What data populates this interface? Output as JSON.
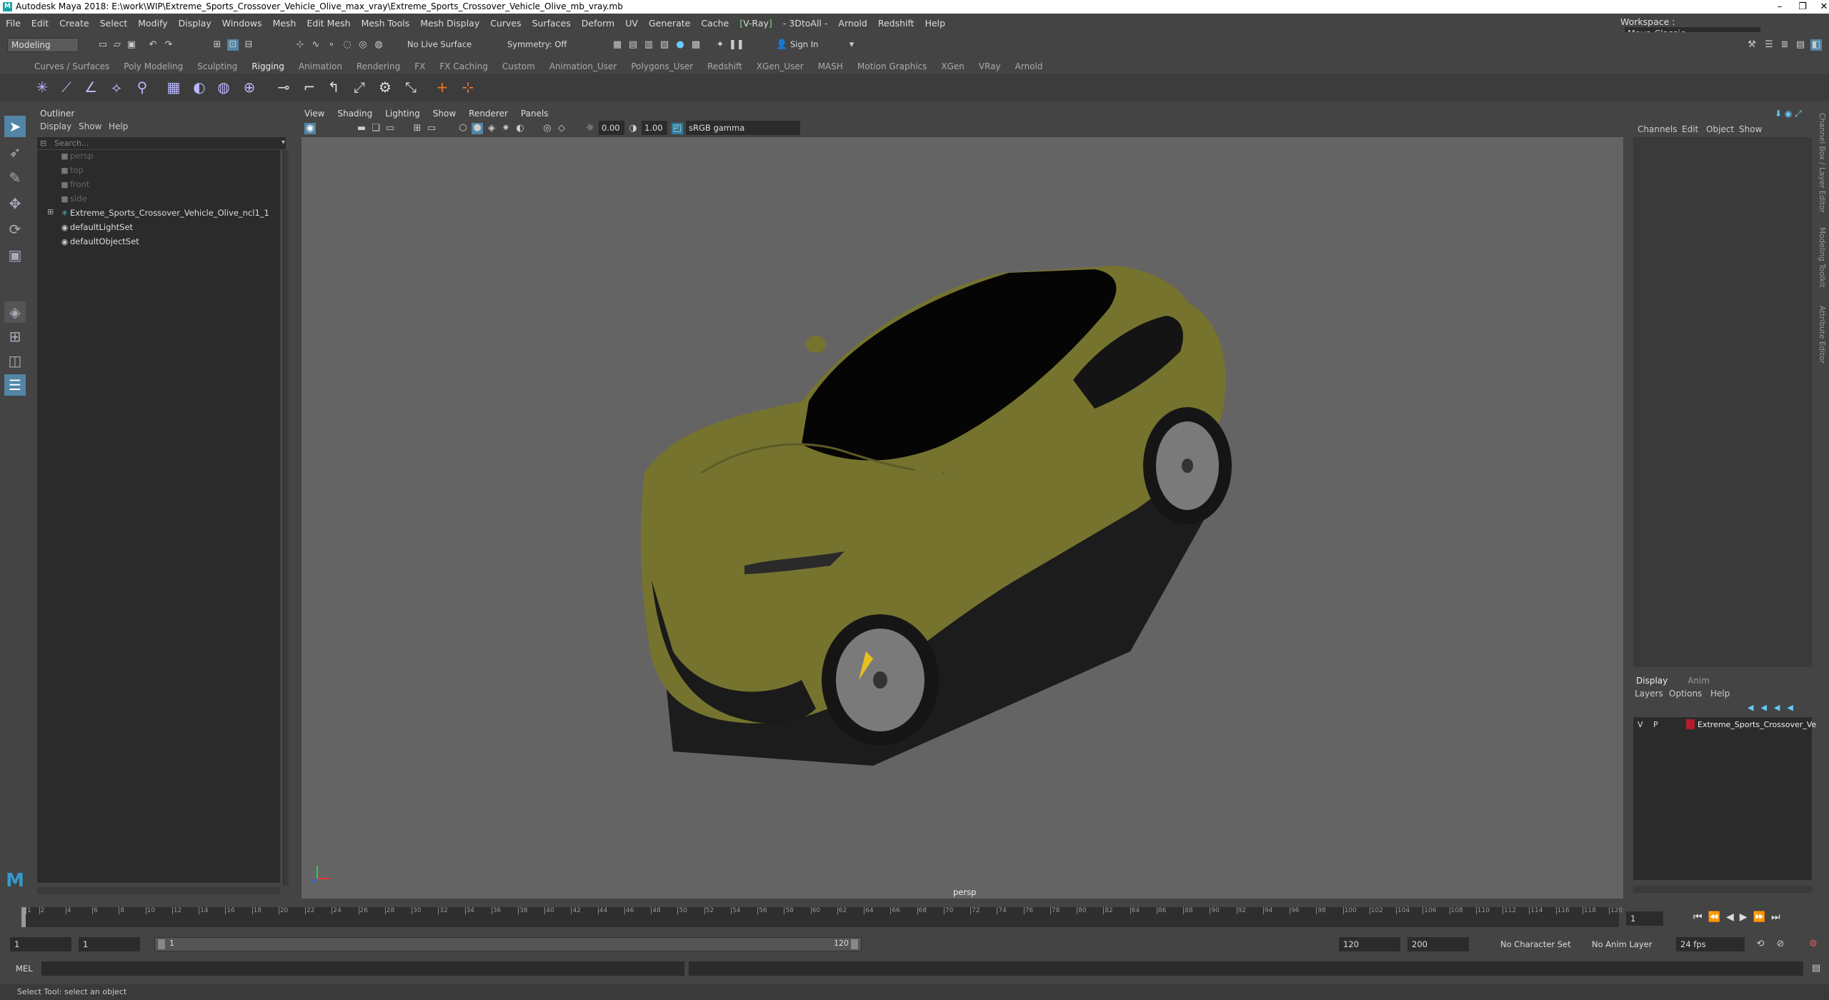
{
  "window": {
    "title": "Autodesk Maya 2018: E:\\work\\WIP\\Extreme_Sports_Crossover_Vehicle_Olive_max_vray\\Extreme_Sports_Crossover_Vehicle_Olive_mb_vray.mb",
    "icon": "maya-icon",
    "buttons": [
      "minimize-icon",
      "restore-icon",
      "close-icon"
    ]
  },
  "menubar": {
    "items": [
      "File",
      "Edit",
      "Create",
      "Select",
      "Modify",
      "Display",
      "Windows",
      "Mesh",
      "Edit Mesh",
      "Mesh Tools",
      "Mesh Display",
      "Curves",
      "Surfaces",
      "Deform",
      "UV",
      "Generate",
      "Cache",
      "V-Ray",
      "3DtoAll",
      "Arnold",
      "Redshift",
      "Help"
    ],
    "vray_color": "#7fe07f",
    "workspace_label": "Workspace :",
    "workspace_value": "Maya Classic"
  },
  "statusline": {
    "mode": "Modeling",
    "live_surface": "No Live Surface",
    "symmetry": "Symmetry: Off",
    "sign_in": "Sign In"
  },
  "shelf": {
    "tabs": [
      "Curves / Surfaces",
      "Poly Modeling",
      "Sculpting",
      "Rigging",
      "Animation",
      "Rendering",
      "FX",
      "FX Caching",
      "Custom",
      "Animation_User",
      "Polygons_User",
      "Redshift",
      "XGen_User",
      "MASH",
      "Motion Graphics",
      "XGen",
      "VRay",
      "Arnold"
    ],
    "active_tab": "Rigging"
  },
  "outliner": {
    "title": "Outliner",
    "menu": [
      "Display",
      "Show",
      "Help"
    ],
    "search_placeholder": "Search...",
    "items": [
      {
        "label": "persp",
        "icon": "camera-icon",
        "dim": true
      },
      {
        "label": "top",
        "icon": "camera-icon",
        "dim": true
      },
      {
        "label": "front",
        "icon": "camera-icon",
        "dim": true
      },
      {
        "label": "side",
        "icon": "camera-icon",
        "dim": true
      },
      {
        "label": "Extreme_Sports_Crossover_Vehicle_Olive_ncl1_1",
        "icon": "group-icon",
        "dim": false,
        "expandable": true
      },
      {
        "label": "defaultLightSet",
        "icon": "set-icon",
        "dim": false
      },
      {
        "label": "defaultObjectSet",
        "icon": "set-icon",
        "dim": false
      }
    ]
  },
  "viewport": {
    "menu": [
      "View",
      "Shading",
      "Lighting",
      "Show",
      "Renderer",
      "Panels"
    ],
    "exposure": "0.00",
    "gamma": "1.00",
    "color_space": "sRGB gamma",
    "camera_label": "persp",
    "car_color": "#76732f"
  },
  "channelbox": {
    "menu": [
      "Channels",
      "Edit",
      "Object",
      "Show"
    ],
    "layer_tabs": [
      "Display",
      "Anim"
    ],
    "layer_menu": [
      "Layers",
      "Options",
      "Help"
    ],
    "layer": {
      "v": "V",
      "p": "P",
      "name": "Extreme_Sports_Crossover_Veh",
      "color": "#b01e2a"
    }
  },
  "side_tabs": [
    "Channel Box / Layer Editor",
    "Modeling Toolkit",
    "Attribute Editor"
  ],
  "timeline": {
    "ticks": [
      "1",
      "2",
      "4",
      "6",
      "8",
      "10",
      "12",
      "14",
      "16",
      "18",
      "20",
      "22",
      "24",
      "26",
      "28",
      "30",
      "32",
      "34",
      "36",
      "38",
      "40",
      "42",
      "44",
      "46",
      "48",
      "50",
      "52",
      "54",
      "56",
      "58",
      "60",
      "62",
      "64",
      "66",
      "68",
      "70",
      "72",
      "74",
      "76",
      "78",
      "80",
      "82",
      "84",
      "86",
      "88",
      "90",
      "92",
      "94",
      "96",
      "98",
      "100",
      "102",
      "104",
      "106",
      "108",
      "110",
      "112",
      "114",
      "116",
      "118",
      "120"
    ],
    "current_frame": "1"
  },
  "range": {
    "start": "1",
    "playback_start": "1",
    "slider_start": "1",
    "slider_end": "120",
    "playback_end": "120",
    "end": "200",
    "character_set": "No Character Set",
    "anim_layer": "No Anim Layer",
    "fps": "24 fps"
  },
  "cmdline": {
    "label": "MEL"
  },
  "helpline": {
    "text": "Select Tool: select an object"
  }
}
